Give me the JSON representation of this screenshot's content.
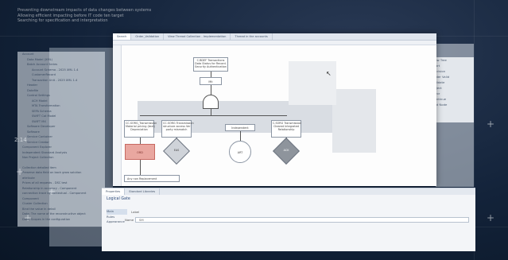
{
  "tagline": [
    "Preventing downstream impacts of data changes between systems",
    "Allowing efficient impacting before IT code ten target",
    "Searching for specification and interpretation"
  ],
  "timecode": "2:14",
  "editor": {
    "tabs": [
      {
        "label": "Search"
      },
      {
        "label": "Order_Validation"
      },
      {
        "label": "View Thread Collection - Implementation"
      },
      {
        "label": "Thread in the accounts"
      }
    ]
  },
  "explorer": {
    "rows": [
      "Account",
      "Data Model (XML)",
      "Batch Account Series",
      "Account Schema - 2025 XML 1.4",
      "CustomerRecord",
      "Transaction Unit - 2025 XML 1.4",
      "Header",
      "Datafile",
      "Control Settings",
      "ACH Model",
      "MTA Transformation",
      "SEPA Schema",
      "SWIFT Cat Model",
      "SWIFT MX",
      "Software Developer",
      "Software",
      "Service Container",
      "Service Creator",
      "Component Explorer",
      "Independent Standard Analysis",
      "Non Project Collection"
    ],
    "footer_rows": [
      "Collection detailed item",
      "Preserve data field on back grow solution",
      "attribute",
      "Prices of all requests - DSC test",
      "Relationship in accuracy - Component",
      "connection trace by contextual - Component",
      "Component",
      "Cluster Collection",
      "Bind the value in detail",
      "Data: The name of the reconstructive object",
      "Data: Scopes in the configuration"
    ]
  },
  "outline": {
    "rows": [
      "Flow Tree",
      "Start",
      "Decision",
      "Order Valid",
      "Validate",
      "Reject",
      "Error",
      "Continue",
      "End Node"
    ]
  },
  "flow": {
    "top_box": "C.BDEF Transactions\nData Status for Record-\nSecurity Authentication",
    "top_rect": "Mit",
    "box1": "CC.SORG_Transmission\nMaterial pricing (text)\nDepreciation",
    "box2": "CC.SORG Transmission\nstructure access Ver\nparty mismatch",
    "box3": "Independent",
    "box4": "C.SORG Transmission\nCleared Integrated\nRelationship",
    "pink": "ORD",
    "dia1": "EAS",
    "circle": "ART",
    "dia2": "ACK",
    "sub_box": "Any non Replacement"
  },
  "props": {
    "tabs": [
      {
        "label": "Properties"
      },
      {
        "label": "Standard Libraries"
      }
    ],
    "title": "Logical Gate",
    "side_labels": [
      "Main",
      "Rules",
      "Appearance"
    ],
    "label": "Label",
    "field_label": "Name",
    "field_value": "SM"
  },
  "colors": {
    "accent": "#e9a7a0",
    "background": "#0e1a2b"
  }
}
